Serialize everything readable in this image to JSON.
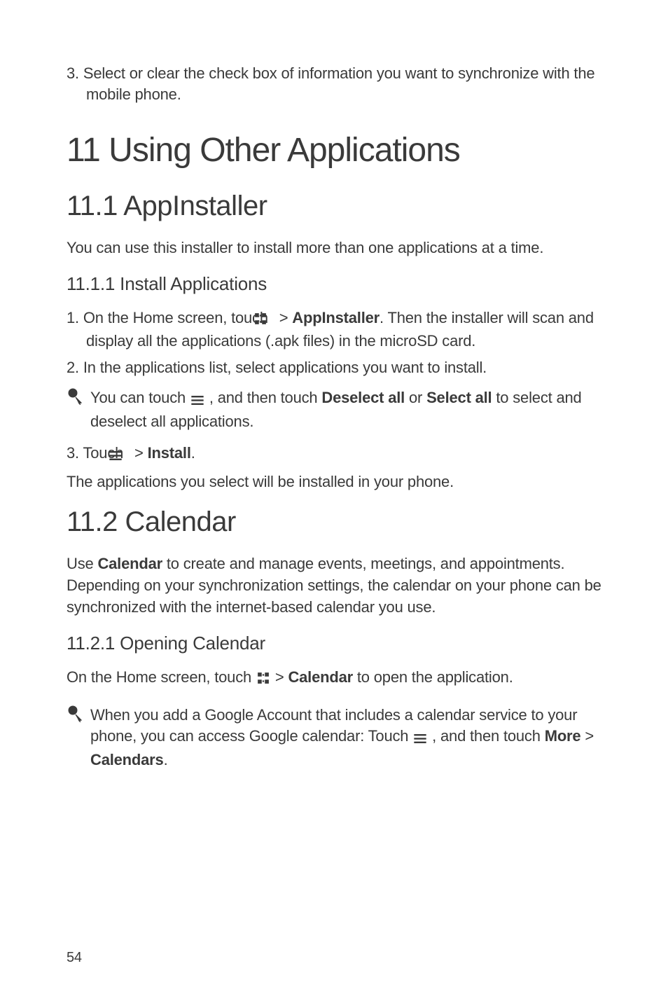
{
  "intro_list_item": "3. Select or clear the check box of information you want to synchronize with the mobile phone.",
  "h1": "11  Using Other Applications",
  "s1": {
    "h2": "11.1  AppInstaller",
    "intro": "You can use this installer to install more than one applications at a time.",
    "sub1": {
      "h3": "11.1.1  Install Applications",
      "step1_a": "1. On the Home screen, touch ",
      "step1_b": " > ",
      "step1_bold": "AppInstaller",
      "step1_c": ". Then the installer will scan and display all the applications (.apk files) in the microSD card.",
      "step2": "2. In the applications list, select applications you want to install.",
      "tip_a": "You can touch ",
      "tip_b": " , and then touch ",
      "tip_bold1": "Deselect all",
      "tip_c": " or ",
      "tip_bold2": "Select all",
      "tip_d": " to select and deselect all applications.",
      "step3_a": "3. Touch ",
      "step3_b": " > ",
      "step3_bold": "Install",
      "step3_c": ".",
      "outro": "The applications you select will be installed in your phone."
    }
  },
  "s2": {
    "h2": "11.2  Calendar",
    "intro_a": "Use ",
    "intro_bold": "Calendar",
    "intro_b": " to create and manage events, meetings, and appointments. Depending on your synchronization settings, the calendar on your phone can be synchronized with the internet-based calendar you use.",
    "sub1": {
      "h3": "11.2.1  Opening Calendar",
      "line_a": "On the Home screen, touch ",
      "line_b": " > ",
      "line_bold": "Calendar",
      "line_c": " to open the application.",
      "tip_a": "When you add a Google Account that includes a calendar service to your phone, you can access Google calendar: Touch ",
      "tip_b": " , and then touch ",
      "tip_bold1": "More",
      "tip_c": " > ",
      "tip_bold2": "Calendars",
      "tip_d": "."
    }
  },
  "page": "54"
}
